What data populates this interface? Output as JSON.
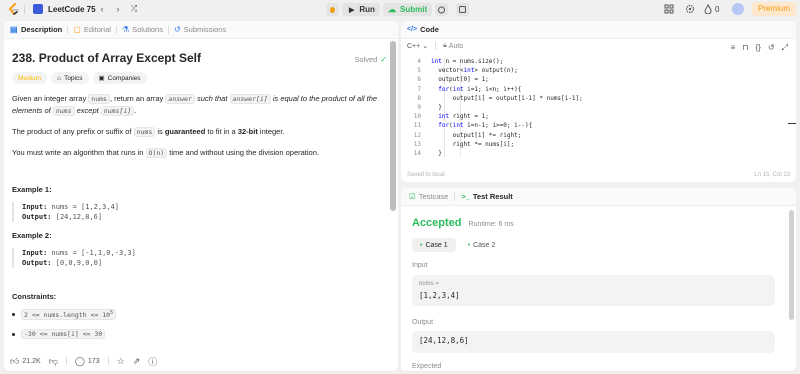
{
  "topbar": {
    "study_plan": "LeetCode 75",
    "run_label": "Run",
    "submit_label": "Submit",
    "streak_count": "0",
    "premium_label": "Premium"
  },
  "left": {
    "tabs": [
      {
        "label": "Description"
      },
      {
        "label": "Editorial"
      },
      {
        "label": "Solutions"
      },
      {
        "label": "Submissions"
      }
    ],
    "title": "238. Product of Array Except Self",
    "solved_label": "Solved",
    "difficulty": "Medium",
    "topics_label": "Topics",
    "companies_label": "Companies",
    "p1": {
      "t1": "Given an integer array ",
      "c1": "nums",
      "t2": ", return an array ",
      "c2": "answer",
      "t3": " such that ",
      "c3": "answer[i]",
      "t4": " is equal to the product of all the elements of ",
      "c4": "nums",
      "t5": " except ",
      "c5": "nums[i]",
      "t6": "."
    },
    "p2": {
      "t1": "The product of any prefix or suffix of ",
      "c1": "nums",
      "t2": " is ",
      "b1": "guaranteed",
      "t3": " to fit in a ",
      "b2": "32-bit",
      "t4": " integer."
    },
    "p3": {
      "t1": "You must write an algorithm that runs in ",
      "c1": "O(n)",
      "t2": " time and without using the division operation."
    },
    "examples": [
      {
        "heading": "Example 1:",
        "input_label": "Input:",
        "input": " nums = [1,2,3,4]",
        "output_label": "Output:",
        "output": " [24,12,8,6]"
      },
      {
        "heading": "Example 2:",
        "input_label": "Input:",
        "input": " nums = [-1,1,0,-3,3]",
        "output_label": "Output:",
        "output": " [0,0,9,0,0]"
      }
    ],
    "constraints_heading": "Constraints:",
    "constraints": [
      {
        "base": "2 <= nums.length <= 10",
        "sup": "5"
      },
      {
        "base": "-30 <= nums[i] <= 30",
        "sup": ""
      }
    ],
    "likes": "21.2K",
    "comments": "173"
  },
  "code": {
    "tab_label": "Code",
    "language": "C++",
    "mode": "Auto",
    "lines": [
      {
        "n": "4",
        "text": "int n = nums.size();"
      },
      {
        "n": "5",
        "text": "  vector<int> output(n);"
      },
      {
        "n": "6",
        "text": "  output[0] = 1;"
      },
      {
        "n": "7",
        "text": "  for(int i=1; i<n; i++){"
      },
      {
        "n": "8",
        "text": "      output[i] = output[i-1] * nums[i-1];"
      },
      {
        "n": "9",
        "text": "  }"
      },
      {
        "n": "10",
        "text": "  int right = 1;"
      },
      {
        "n": "11",
        "text": "  for(int i=n-1; i>=0; i--){"
      },
      {
        "n": "12",
        "text": "      output[i] *= right;"
      },
      {
        "n": "13",
        "text": "      right *= nums[i];"
      },
      {
        "n": "14",
        "text": "  }"
      }
    ],
    "saved": "Saved to local",
    "cursor": "Ln 15, Col 23"
  },
  "result": {
    "tab_testcase": "Testcase",
    "tab_result": "Test Result",
    "status": "Accepted",
    "runtime": "Runtime: 6 ms",
    "cases": [
      "Case 1",
      "Case 2"
    ],
    "input_label": "Input",
    "input_var": "nums =",
    "input_value": "[1,2,3,4]",
    "output_label": "Output",
    "output_value": "[24,12,8,6]",
    "expected_label": "Expected"
  }
}
